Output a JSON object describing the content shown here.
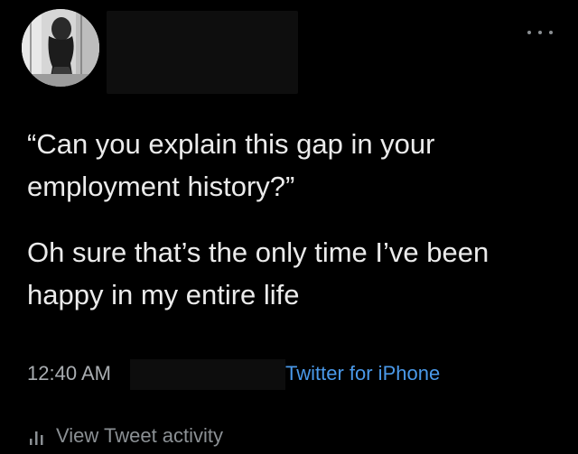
{
  "tweet": {
    "paragraphs": [
      "“Can you explain this gap in your employment history?”",
      "Oh sure that’s the only time I’ve been happy in my entire life"
    ],
    "time": "12:40 AM",
    "source": "Twitter for iPhone",
    "activity_label": "View Tweet activity",
    "more_icon": "more-horizontal-icon",
    "activity_icon": "bar-chart-icon"
  },
  "colors": {
    "background": "#000000",
    "text": "#ebebeb",
    "muted": "#a9adb1",
    "link": "#4a99e9"
  }
}
